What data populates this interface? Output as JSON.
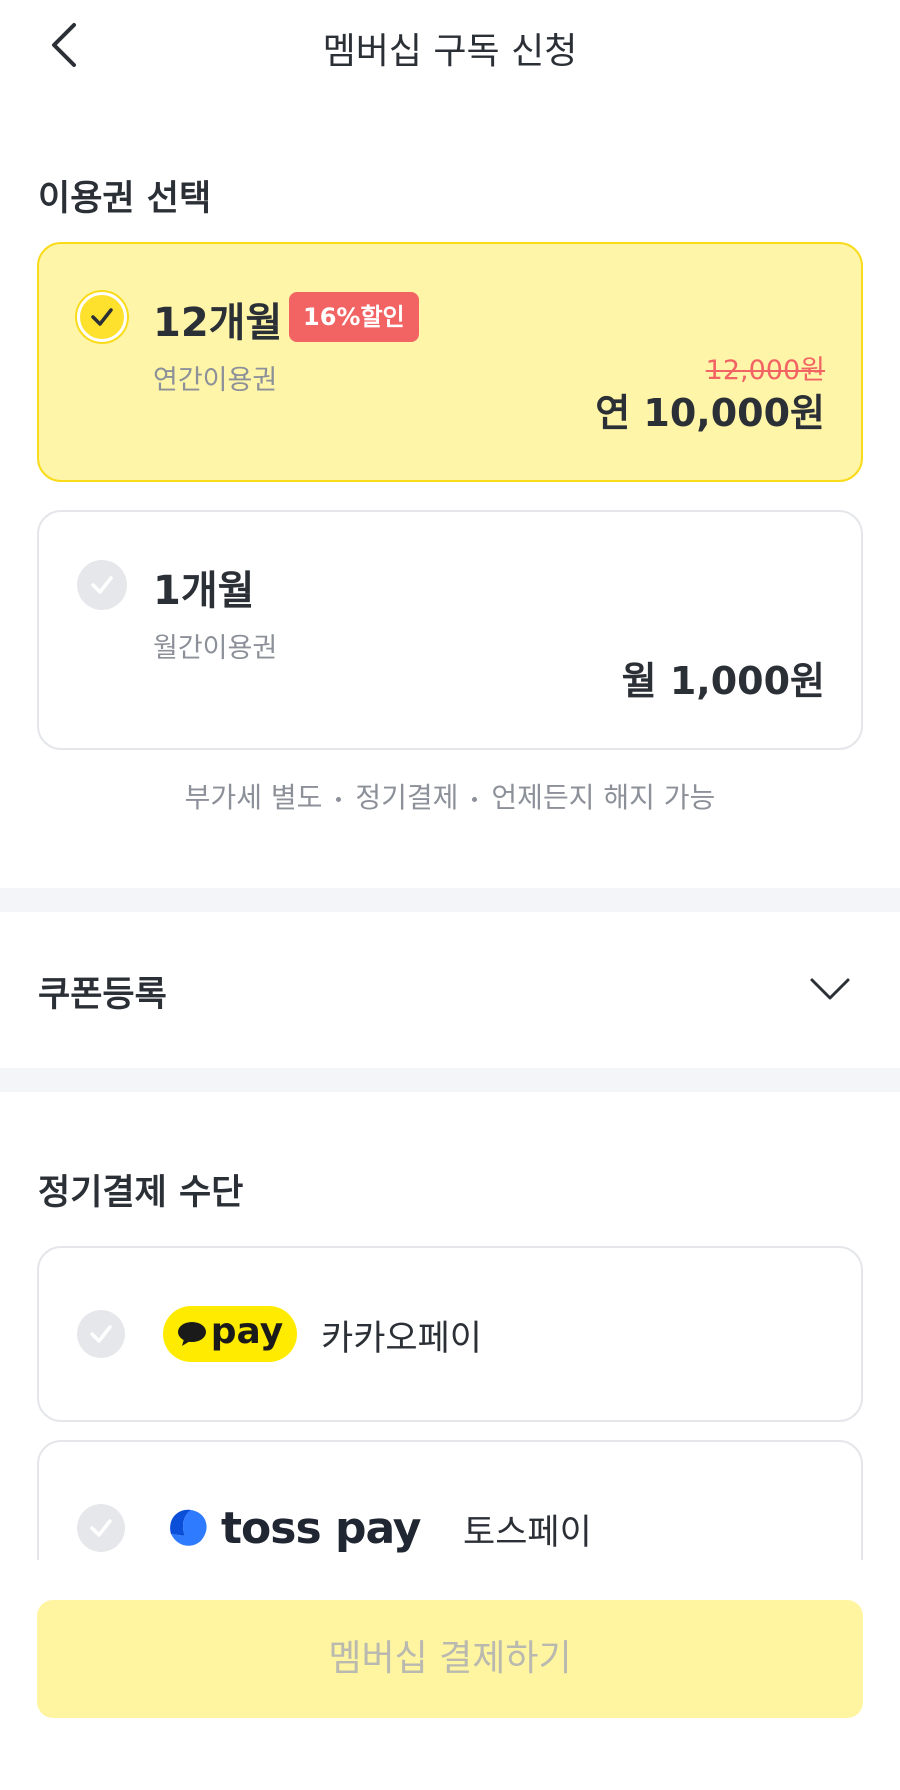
{
  "header": {
    "title": "멤버십 구독 신청"
  },
  "plan_section": {
    "title": "이용권 선택",
    "plans": [
      {
        "name": "12개월",
        "badge": "16%할인",
        "subtitle": "연간이용권",
        "original_price": "12,000원",
        "price": "연 10,000원",
        "selected": true
      },
      {
        "name": "1개월",
        "subtitle": "월간이용권",
        "price": "월 1,000원",
        "selected": false
      }
    ],
    "notice": [
      "부가세 별도",
      "정기결제",
      "언제든지 해지 가능"
    ]
  },
  "coupon": {
    "label": "쿠폰등록"
  },
  "payment_section": {
    "title": "정기결제 수단",
    "methods": [
      {
        "logo_text": "pay",
        "name": "카카오페이",
        "selected": false
      },
      {
        "logo_text": "toss pay",
        "name": "토스페이",
        "selected": false
      }
    ]
  },
  "footer": {
    "button_label": "멤버십 결제하기"
  },
  "colors": {
    "accent_yellow": "#fde12d",
    "selected_card_bg": "#fff5a8",
    "discount_red": "#f26464",
    "toss_blue": "#1b64f2"
  }
}
